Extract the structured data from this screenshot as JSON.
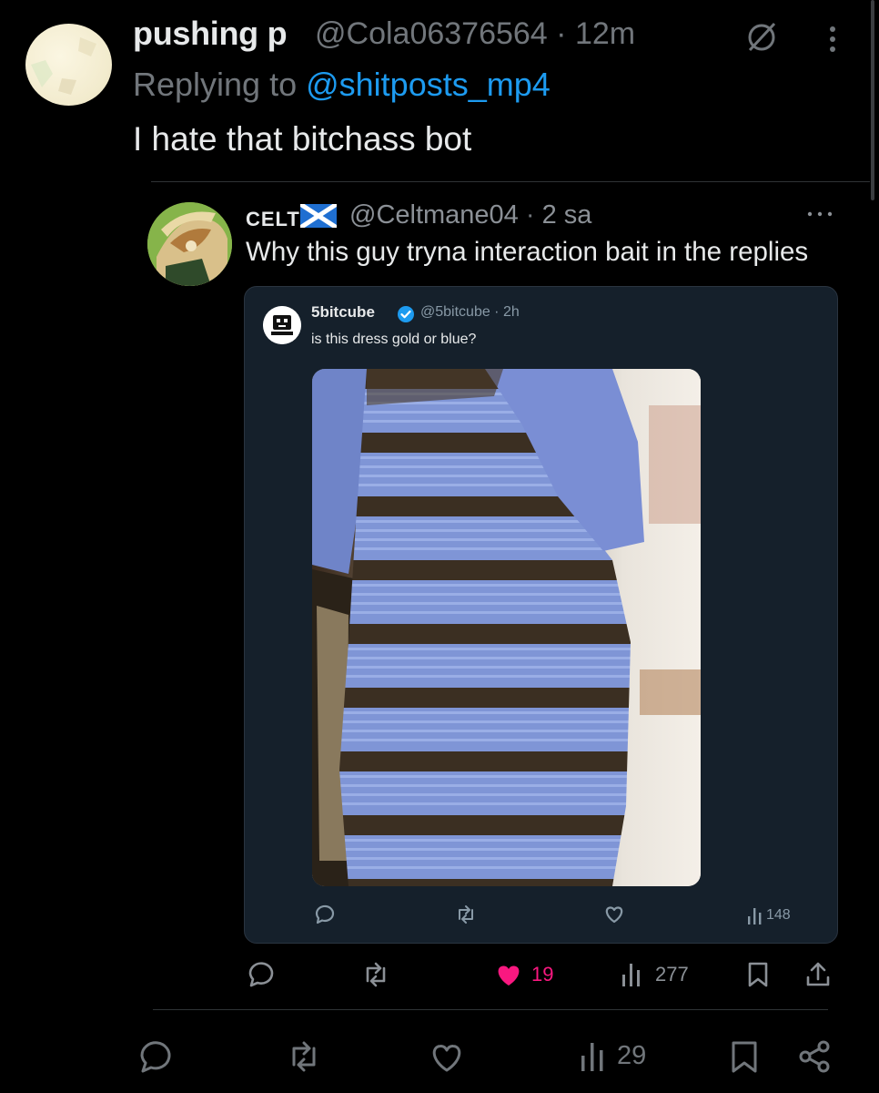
{
  "tweet": {
    "author_name": "pushing p",
    "author_handle": "@Cola06376564",
    "time": "12m",
    "replying_prefix": "Replying to ",
    "replying_to": "@shitposts_mp4",
    "text": "I hate that bitchass bot",
    "views": "29",
    "icons": [
      "grok-icon",
      "more-vertical-icon",
      "reply-icon",
      "retweet-icon",
      "like-icon",
      "views-icon",
      "bookmark-icon",
      "share-icon"
    ]
  },
  "quoted_reply": {
    "author_name": "CELT†",
    "flag": "scotland-flag-icon",
    "author_handle": "@Celtmane04",
    "time": "2 sa",
    "text": "Why this guy tryna interaction bait in the replies",
    "likes": "19",
    "views": "277",
    "like_color": "#f91880"
  },
  "embedded_tweet": {
    "author_name": "5bitcube",
    "author_handle": "@5bitcube",
    "time": "2h",
    "text": "is this dress gold or blue?",
    "views": "148",
    "verified_color": "#1d9bf0"
  },
  "colors": {
    "background": "#000000",
    "card_background": "#15202b",
    "link": "#1d9bf0",
    "muted": "#71767b"
  }
}
